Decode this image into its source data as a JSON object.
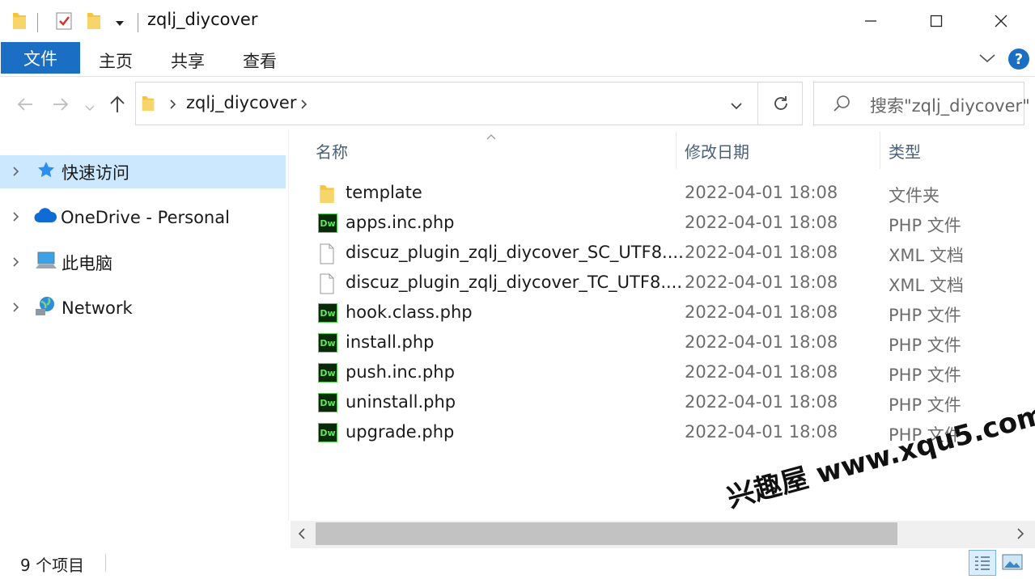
{
  "window": {
    "title": "zqlj_diycover",
    "controls": {
      "minimize": "—",
      "maximize": "☐",
      "close": "✕"
    }
  },
  "ribbon": {
    "file_tab": "文件",
    "tabs": [
      "主页",
      "共享",
      "查看"
    ],
    "help": "?"
  },
  "address": {
    "path": "zqlj_diycover",
    "search_placeholder": "搜索\"zqlj_diycover\""
  },
  "sidebar": {
    "items": [
      {
        "label": "快速访问",
        "icon": "star-icon",
        "selected": true
      },
      {
        "label": "OneDrive - Personal",
        "icon": "cloud-icon",
        "selected": false
      },
      {
        "label": "此电脑",
        "icon": "computer-icon",
        "selected": false
      },
      {
        "label": "Network",
        "icon": "network-icon",
        "selected": false
      }
    ]
  },
  "columns": {
    "name": "名称",
    "date": "修改日期",
    "type": "类型"
  },
  "files": [
    {
      "name": "template",
      "date": "2022-04-01 18:08",
      "type": "文件夹",
      "icon": "folder-icon"
    },
    {
      "name": "apps.inc.php",
      "date": "2022-04-01 18:08",
      "type": "PHP 文件",
      "icon": "dw-icon"
    },
    {
      "name": "discuz_plugin_zqlj_diycover_SC_UTF8....",
      "date": "2022-04-01 18:08",
      "type": "XML 文档",
      "icon": "file-icon"
    },
    {
      "name": "discuz_plugin_zqlj_diycover_TC_UTF8....",
      "date": "2022-04-01 18:08",
      "type": "XML 文档",
      "icon": "file-icon"
    },
    {
      "name": "hook.class.php",
      "date": "2022-04-01 18:08",
      "type": "PHP 文件",
      "icon": "dw-icon"
    },
    {
      "name": "install.php",
      "date": "2022-04-01 18:08",
      "type": "PHP 文件",
      "icon": "dw-icon"
    },
    {
      "name": "push.inc.php",
      "date": "2022-04-01 18:08",
      "type": "PHP 文件",
      "icon": "dw-icon"
    },
    {
      "name": "uninstall.php",
      "date": "2022-04-01 18:08",
      "type": "PHP 文件",
      "icon": "dw-icon"
    },
    {
      "name": "upgrade.php",
      "date": "2022-04-01 18:08",
      "type": "PHP 文件",
      "icon": "dw-icon"
    }
  ],
  "dw_label": "Dw",
  "status": {
    "count": "9 个项目"
  },
  "watermark": "兴趣屋 www.xqu5.com",
  "colors": {
    "accent": "#1a6fc4",
    "selection": "#cce8ff",
    "folder": "#f5c441"
  }
}
